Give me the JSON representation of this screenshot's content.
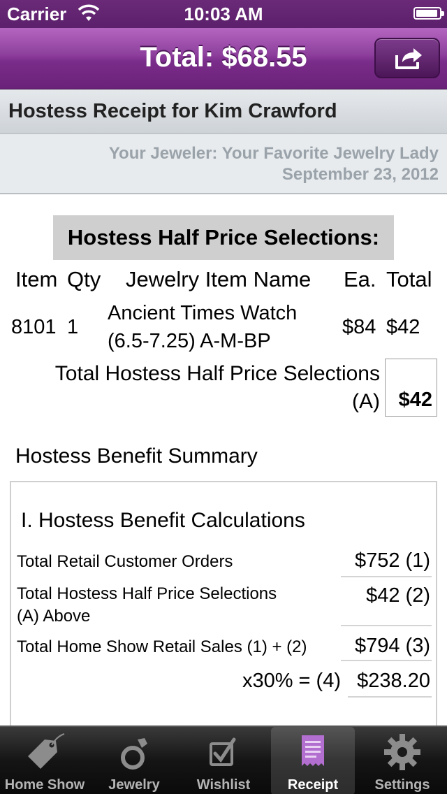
{
  "status_bar": {
    "carrier": "Carrier",
    "time": "10:03 AM"
  },
  "nav": {
    "title": "Total: $68.55",
    "share_icon": "share-icon"
  },
  "header": {
    "title": "Hostess Receipt for Kim Crawford",
    "jeweler": "Your Jeweler: Your Favorite Jewelry Lady",
    "date": "September 23, 2012"
  },
  "selections": {
    "heading": "Hostess Half Price Selections:",
    "columns": [
      "Item",
      "Qty",
      "Jewelry Item Name",
      "Ea.",
      "Total"
    ],
    "rows": [
      {
        "item": "8101",
        "qty": "1",
        "name_line1": "Ancient Times Watch",
        "name_line2": "(6.5-7.25) A-M-BP",
        "each": "$84",
        "total": "$42"
      }
    ],
    "total_label_line1": "Total Hostess Half Price Selections",
    "total_label_line2": "(A)",
    "total_value": "$42"
  },
  "benefit": {
    "title": "Hostess Benefit Summary",
    "calc_title": "I. Hostess Benefit Calculations",
    "rows": [
      {
        "label": "Total Retail Customer Orders",
        "value": "$752 (1)"
      },
      {
        "label_line1": "Total Hostess Half Price Selections",
        "label_line2": "(A) Above",
        "value": "$42 (2)"
      },
      {
        "label": "Total Home Show Retail Sales (1) + (2)",
        "value": "$794 (3)"
      },
      {
        "label": "x30% = (4)",
        "value": "$238.20"
      }
    ]
  },
  "tabs": [
    {
      "label": "Home Show",
      "icon": "price-tag-icon",
      "active": false
    },
    {
      "label": "Jewelry",
      "icon": "ring-icon",
      "active": false
    },
    {
      "label": "Wishlist",
      "icon": "checkbox-icon",
      "active": false
    },
    {
      "label": "Receipt",
      "icon": "receipt-icon",
      "active": true
    },
    {
      "label": "Settings",
      "icon": "gear-icon",
      "active": false
    }
  ],
  "colors": {
    "nav_purple": "#8d3e9c",
    "status_purple": "#5c1f6b",
    "receipt_icon_purple": "#b36fd0"
  }
}
